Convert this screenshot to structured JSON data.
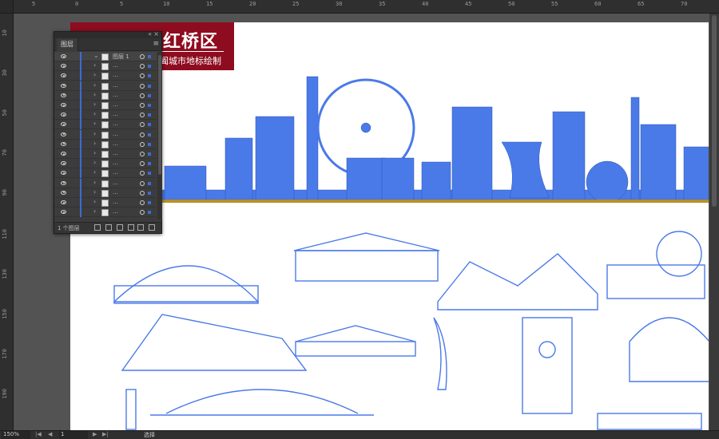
{
  "artboard": {
    "title": "红桥区",
    "subtitle": "阖城市地标绘制"
  },
  "layers_panel": {
    "tab_label": "图层",
    "top_layer_name": "图层 1",
    "sublayer_name": "…",
    "footer_count": "1 个图层"
  },
  "status_bar": {
    "zoom": "150%",
    "page": "1",
    "tool": "选择"
  },
  "colors": {
    "accent": "#3d6bd4",
    "landmark_blue": "#4a7ae8",
    "title_bg": "#8e0c1f",
    "gold": "#b8902a"
  },
  "icons": [
    "eye-icon",
    "chevron-right-icon",
    "target-icon",
    "search-icon",
    "new-layer-icon",
    "delete-icon"
  ]
}
